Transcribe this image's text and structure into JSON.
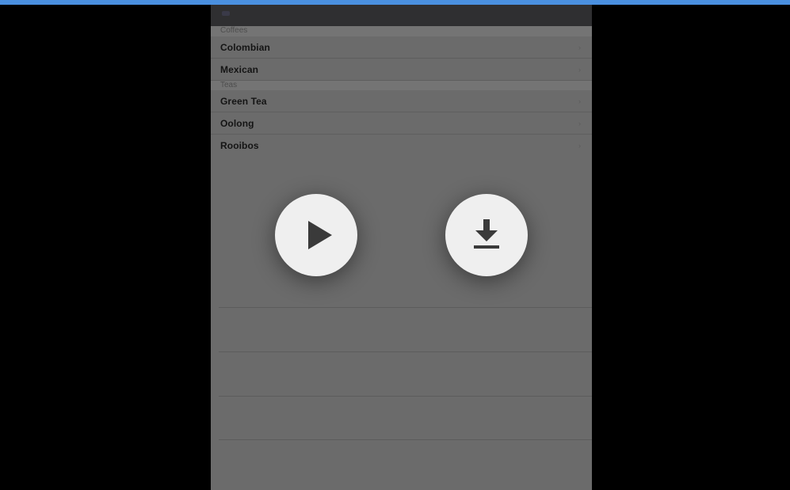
{
  "screen": {
    "accent_color": "#4a90e0",
    "overlay_bg": "#6b6b6b"
  },
  "nav": {
    "back_icon": "back-icon"
  },
  "sections": [
    {
      "header": "Coffees",
      "items": [
        {
          "label": "Colombian",
          "chevron": "›"
        },
        {
          "label": "Mexican",
          "chevron": "›"
        }
      ]
    },
    {
      "header": "Teas",
      "items": [
        {
          "label": "Green Tea",
          "chevron": "›"
        },
        {
          "label": "Oolong",
          "chevron": "›"
        },
        {
          "label": "Rooibos",
          "chevron": "›"
        }
      ]
    }
  ],
  "overlay": {
    "play_icon": "play-icon",
    "download_icon": "download-icon"
  }
}
